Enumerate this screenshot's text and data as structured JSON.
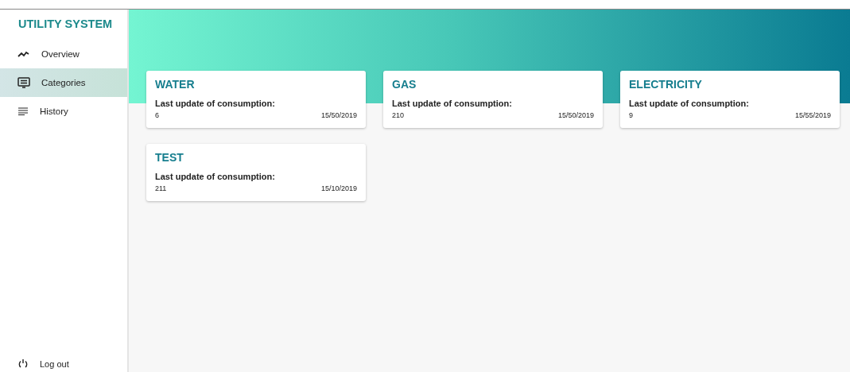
{
  "sidebar": {
    "title": "UTILITY SYSTEM",
    "items": [
      {
        "label": "Overview",
        "kind": "trend",
        "selected": false
      },
      {
        "label": "Categories",
        "kind": "screen",
        "selected": true
      },
      {
        "label": "History",
        "kind": "lines",
        "selected": false
      }
    ],
    "logout": "Log out"
  },
  "cards": [
    {
      "title": "WATER",
      "subtitle": "Last update of consumption:",
      "value": "6",
      "date": "15/50/2019"
    },
    {
      "title": "GAS",
      "subtitle": "Last update of consumption:",
      "value": "210",
      "date": "15/50/2019"
    },
    {
      "title": "ELECTRICITY",
      "subtitle": "Last update of consumption:",
      "value": "9",
      "date": "15/55/2019"
    },
    {
      "title": "TEST",
      "subtitle": "Last update of consumption:",
      "value": "211",
      "date": "15/10/2019"
    }
  ]
}
